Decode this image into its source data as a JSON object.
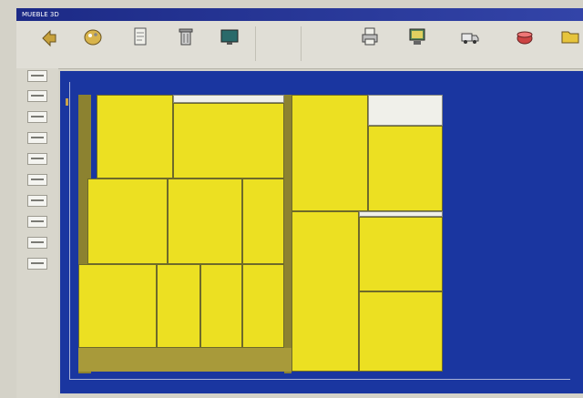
{
  "window": {
    "title": "MUEBLE 3D"
  },
  "toolbar": {
    "buttons": [
      {
        "icon": "back-icon",
        "label": ""
      },
      {
        "icon": "palette-icon",
        "label": ""
      },
      {
        "icon": "document-icon",
        "label": ""
      },
      {
        "icon": "trash-icon",
        "label": ""
      },
      {
        "icon": "monitor-icon",
        "label": ""
      },
      {
        "icon": "blank-icon",
        "label": ""
      },
      {
        "icon": "blank-icon",
        "label": ""
      },
      {
        "icon": "printer-icon",
        "label": ""
      },
      {
        "icon": "screen-icon",
        "label": ""
      },
      {
        "icon": "truck-icon",
        "label": ""
      },
      {
        "icon": "cup-icon",
        "label": ""
      },
      {
        "icon": "folder-icon",
        "label": ""
      }
    ]
  },
  "sidebar": {
    "buttons": [
      "tool-1",
      "tool-2",
      "tool-3",
      "tool-4",
      "tool-5",
      "tool-6",
      "tool-7",
      "tool-8",
      "tool-9",
      "tool-10"
    ]
  },
  "canvas": {
    "axis_x_label": "",
    "axis_y_label": "",
    "corner_label": ""
  },
  "colors": {
    "canvas_bg": "#1a36a0",
    "cabinet_fill": "#ece022",
    "cabinet_shadow": "#8c8230",
    "frame_bg": "#d4d2c8"
  }
}
